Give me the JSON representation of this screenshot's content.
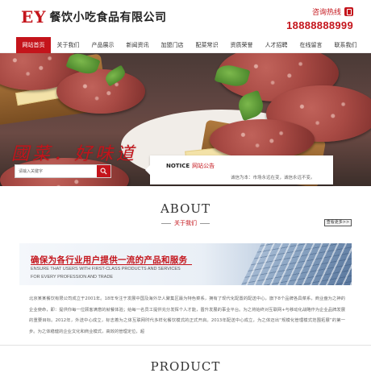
{
  "header": {
    "logo_ey": "EY",
    "logo_name": "餐饮小吃食品有限公司",
    "hotline_label": "咨询热线",
    "hotline_number": "18888888999"
  },
  "nav": {
    "items": [
      "网站首页",
      "关于我们",
      "产品展示",
      "新闻资讯",
      "加盟门店",
      "配菜常识",
      "资质荣誉",
      "人才招聘",
      "在线留言",
      "联系我们"
    ],
    "active_index": 0
  },
  "banner": {
    "slogan": "國菜．好味道"
  },
  "search": {
    "placeholder": "请输入关键字"
  },
  "notice": {
    "title": "NOTICE",
    "title_cn": "网站公告",
    "text": "诚信为本：市场永远在变，诚信永远不变。"
  },
  "about": {
    "title": "ABOUT",
    "subtitle": "关于我们",
    "more": "查看更多>>",
    "banner_cn": "确保为各行业用户提供一流的产品和服务",
    "banner_en1": "ENSURE THAT USERS WITH FIRST-CLASS PRODUCTS AND SERVICES",
    "banner_en2": "FOR EVERY PROFESSION AND TRADE",
    "text": "北京某某餐饮有限公司成立于2001年。18年专注于发展中国及海外华人聚集区最为特色菜系，拥有了现代化配置的配送中心，旗下8个品牌各具菜系，商业盘为之神的企业使命，即：提供你每一位顾客满意的就餐体验；给每一名员工提供充分发挥个人才能，晋升发展的事业平台。为之将始终对互联网+与移动化战略作为企业品牌发展的重要目标。2012年，外送中心成立，标志着为之体互联网时代多样化餐饮模式的正式开启。2013年配送中心成立，为之体迈出“规模化管理模式范围拓展”的第一步。为之体稳健的企业文化和商业模式，高效的管理定位，超"
  },
  "product": {
    "title": "PRODUCT"
  }
}
